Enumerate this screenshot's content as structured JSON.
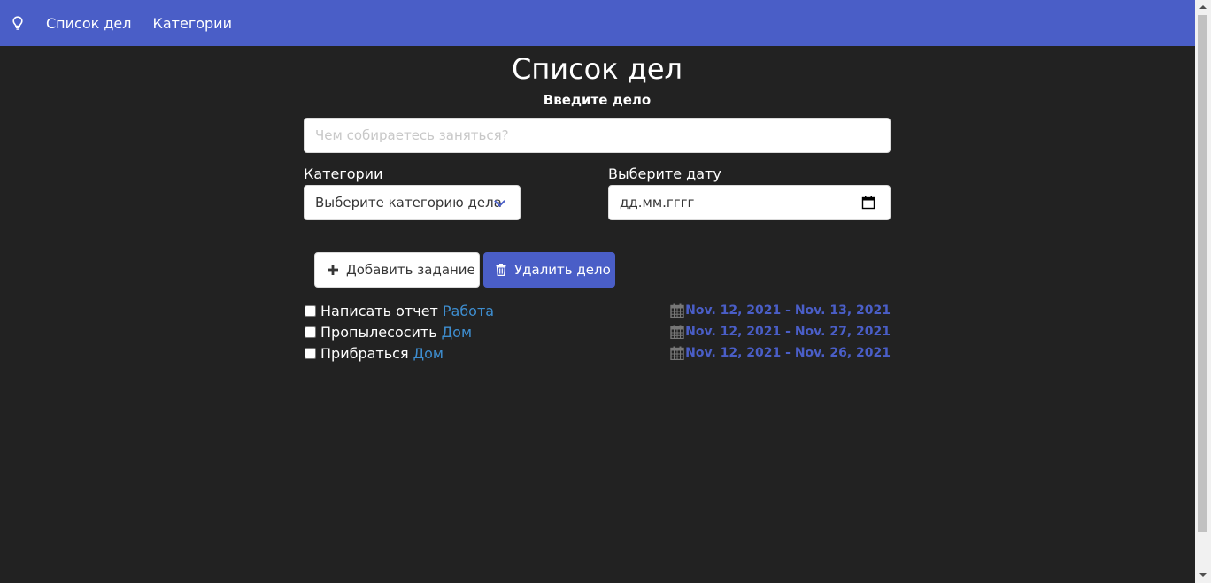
{
  "nav": {
    "logo_icon": "lightbulb-icon",
    "links": [
      "Список дел",
      "Категории"
    ]
  },
  "header": {
    "title": "Список дел",
    "subtitle": "Введите дело"
  },
  "form": {
    "task_placeholder": "Чем собираетесь заняться?",
    "category_label": "Категории",
    "category_select": "Выберите категорию дела",
    "date_label": "Выберите дату",
    "date_placeholder": "дд.мм.гггг"
  },
  "buttons": {
    "add": "Добавить задание",
    "delete": "Удалить дело"
  },
  "tasks": [
    {
      "name": "Написать отчет",
      "category": "Работа",
      "dates": "Nov. 12, 2021 - Nov. 13, 2021"
    },
    {
      "name": "Пропылесосить",
      "category": "Дом",
      "dates": "Nov. 12, 2021 - Nov. 27, 2021"
    },
    {
      "name": "Прибраться",
      "category": "Дом",
      "dates": "Nov. 12, 2021 - Nov. 26, 2021"
    }
  ],
  "colors": {
    "navbar": "#4a5ec7",
    "background": "#222222",
    "category_link": "#3e8ed0",
    "date_text": "#4a5ec7"
  }
}
